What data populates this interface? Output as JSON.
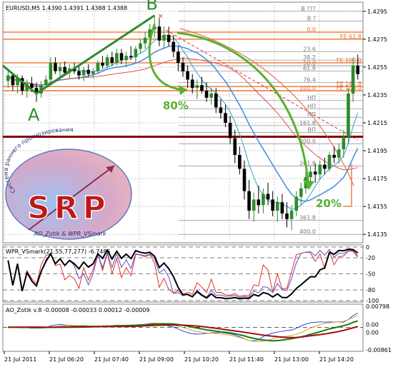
{
  "colors": {
    "bull": "#2e8b2e",
    "bear": "#000000",
    "green_annot": "#58b030",
    "orange": "#f08040",
    "darkred": "#800000",
    "blue": "#3c8ce0",
    "wpr_red": "#e03030"
  },
  "chart_data": [
    {
      "type": "candlestick",
      "header": "EURUSD,M5  1.4390 1.4391 1.4388 1.4388",
      "ylim": [
        1.413,
        1.43
      ],
      "y_ticks": [
        "1.4295",
        "1.4275",
        "1.4255",
        "1.4235",
        "1.4215",
        "1.4195",
        "1.4175",
        "1.4155",
        "1.4135"
      ],
      "x_ticks": [
        "21 Jul 2011",
        "21 Jul 06:20",
        "21 Jul 07:40",
        "21 Jul 09:00",
        "21 Jul 10:20",
        "21 Jul 11:40",
        "21 Jul 13:00",
        "21 Jul 14:20"
      ],
      "candles": [
        [
          1.4245,
          1.4252,
          1.424,
          1.4249
        ],
        [
          1.4249,
          1.4251,
          1.4238,
          1.4242
        ],
        [
          1.4242,
          1.425,
          1.4236,
          1.4247
        ],
        [
          1.4247,
          1.4249,
          1.4235,
          1.4238
        ],
        [
          1.4238,
          1.4246,
          1.4233,
          1.4243
        ],
        [
          1.4243,
          1.4248,
          1.4237,
          1.424
        ],
        [
          1.424,
          1.4244,
          1.423,
          1.4236
        ],
        [
          1.4236,
          1.4245,
          1.4233,
          1.4242
        ],
        [
          1.4242,
          1.4249,
          1.424,
          1.4246
        ],
        [
          1.4246,
          1.4262,
          1.4244,
          1.4258
        ],
        [
          1.4258,
          1.4262,
          1.425,
          1.4252
        ],
        [
          1.4252,
          1.4258,
          1.4248,
          1.4255
        ],
        [
          1.4255,
          1.4259,
          1.4249,
          1.4251
        ],
        [
          1.4251,
          1.4257,
          1.4247,
          1.4254
        ],
        [
          1.4254,
          1.4258,
          1.425,
          1.4252
        ],
        [
          1.4252,
          1.4256,
          1.4246,
          1.4249
        ],
        [
          1.4249,
          1.4255,
          1.4245,
          1.4253
        ],
        [
          1.4253,
          1.4257,
          1.4248,
          1.425
        ],
        [
          1.425,
          1.4254,
          1.4247,
          1.4252
        ],
        [
          1.4252,
          1.426,
          1.425,
          1.4258
        ],
        [
          1.4258,
          1.4263,
          1.4254,
          1.4256
        ],
        [
          1.4256,
          1.4264,
          1.4254,
          1.4262
        ],
        [
          1.4262,
          1.4266,
          1.4256,
          1.4258
        ],
        [
          1.4258,
          1.4268,
          1.4256,
          1.4265
        ],
        [
          1.4265,
          1.4268,
          1.4257,
          1.426
        ],
        [
          1.426,
          1.4266,
          1.4255,
          1.4263
        ],
        [
          1.4263,
          1.427,
          1.426,
          1.4262
        ],
        [
          1.4262,
          1.427,
          1.4258,
          1.4268
        ],
        [
          1.4268,
          1.4275,
          1.4265,
          1.4272
        ],
        [
          1.4272,
          1.428,
          1.4268,
          1.4276
        ],
        [
          1.4276,
          1.4286,
          1.4272,
          1.4282
        ],
        [
          1.4282,
          1.4292,
          1.4276,
          1.4284
        ],
        [
          1.4284,
          1.429,
          1.427,
          1.4274
        ],
        [
          1.4274,
          1.4284,
          1.4268,
          1.4278
        ],
        [
          1.4278,
          1.4284,
          1.427,
          1.4273
        ],
        [
          1.4273,
          1.4278,
          1.4262,
          1.4266
        ],
        [
          1.4266,
          1.427,
          1.4252,
          1.4258
        ],
        [
          1.4258,
          1.4262,
          1.4248,
          1.4252
        ],
        [
          1.4252,
          1.4256,
          1.424,
          1.4246
        ],
        [
          1.4246,
          1.425,
          1.4236,
          1.424
        ],
        [
          1.424,
          1.4246,
          1.4232,
          1.4242
        ],
        [
          1.4242,
          1.4248,
          1.4236,
          1.4238
        ],
        [
          1.4238,
          1.4244,
          1.423,
          1.4233
        ],
        [
          1.4233,
          1.424,
          1.4228,
          1.4236
        ],
        [
          1.4236,
          1.424,
          1.4222,
          1.4226
        ],
        [
          1.4226,
          1.4232,
          1.4218,
          1.4222
        ],
        [
          1.4222,
          1.4228,
          1.4212,
          1.4215
        ],
        [
          1.4215,
          1.422,
          1.42,
          1.4204
        ],
        [
          1.4204,
          1.421,
          1.4186,
          1.4192
        ],
        [
          1.4192,
          1.4198,
          1.4178,
          1.4182
        ],
        [
          1.4182,
          1.4188,
          1.416,
          1.4166
        ],
        [
          1.4166,
          1.4174,
          1.4146,
          1.4152
        ],
        [
          1.4152,
          1.4165,
          1.4144,
          1.416
        ],
        [
          1.416,
          1.417,
          1.415,
          1.4156
        ],
        [
          1.4156,
          1.4168,
          1.415,
          1.4164
        ],
        [
          1.4164,
          1.4172,
          1.4156,
          1.416
        ],
        [
          1.416,
          1.4166,
          1.4148,
          1.4152
        ],
        [
          1.4152,
          1.4162,
          1.4144,
          1.4158
        ],
        [
          1.4158,
          1.4164,
          1.4146,
          1.415
        ],
        [
          1.415,
          1.4158,
          1.414,
          1.4146
        ],
        [
          1.4146,
          1.4156,
          1.4138,
          1.4152
        ],
        [
          1.4152,
          1.4166,
          1.4148,
          1.4162
        ],
        [
          1.4162,
          1.4172,
          1.4156,
          1.4168
        ],
        [
          1.4168,
          1.418,
          1.4164,
          1.4176
        ],
        [
          1.4176,
          1.4184,
          1.417,
          1.418
        ],
        [
          1.418,
          1.4186,
          1.4172,
          1.4178
        ],
        [
          1.4178,
          1.4188,
          1.4174,
          1.4185
        ],
        [
          1.4185,
          1.419,
          1.4178,
          1.4182
        ],
        [
          1.4182,
          1.4194,
          1.418,
          1.4192
        ],
        [
          1.4192,
          1.4198,
          1.4186,
          1.419
        ],
        [
          1.419,
          1.42,
          1.4186,
          1.4196
        ],
        [
          1.4196,
          1.421,
          1.419,
          1.4205
        ],
        [
          1.4205,
          1.424,
          1.42,
          1.4236
        ],
        [
          1.4236,
          1.4262,
          1.423,
          1.4256
        ],
        [
          1.4256,
          1.4264,
          1.4246,
          1.425
        ]
      ],
      "fib_levels": [
        {
          "label": "B ???",
          "price": 1.4295,
          "color": "#777777"
        },
        {
          "label": "B ?",
          "price": 1.4288,
          "color": "#777777"
        },
        {
          "label": "0.0",
          "price": 1.428,
          "color": "#e07030"
        },
        {
          "label": "23.6",
          "price": 1.4266,
          "color": "#777777"
        },
        {
          "label": "38.2",
          "price": 1.426,
          "color": "#777777"
        },
        {
          "label": "50.0",
          "price": 1.4256,
          "color": "#777777"
        },
        {
          "label": "61.8",
          "price": 1.4252,
          "color": "#777777"
        },
        {
          "label": "76.4",
          "price": 1.4244,
          "color": "#777777"
        },
        {
          "label": "100.0",
          "price": 1.4238,
          "color": "#e07030"
        },
        {
          "label": "НП",
          "price": 1.4231,
          "color": "#777777"
        },
        {
          "label": "НП",
          "price": 1.4225,
          "color": "#777777"
        },
        {
          "label": "НП",
          "price": 1.4219,
          "color": "#777777"
        },
        {
          "label": "161.8",
          "price": 1.4213,
          "color": "#777777"
        },
        {
          "label": "ВП",
          "price": 1.4208,
          "color": "#777777"
        },
        {
          "label": "200.0",
          "price": 1.42,
          "color": "#777777"
        },
        {
          "label": "261.8",
          "price": 1.4184,
          "color": "#777777"
        },
        {
          "label": "361.8",
          "price": 1.4145,
          "color": "#777777"
        },
        {
          "label": "400.0",
          "price": 1.4135,
          "color": "#777777"
        }
      ],
      "fe_levels": [
        {
          "label": "FE 61.8",
          "price": 1.4275
        },
        {
          "label": "FE 100.0",
          "price": 1.4258
        },
        {
          "label": "FE 161.8",
          "price": 1.4241
        },
        {
          "label": "FE 100.0",
          "price": 1.4238
        }
      ],
      "support_price": 1.4205,
      "annotations": {
        "point_a": "A",
        "point_b": "B",
        "pct_80": "80%",
        "pct_20": "20%"
      },
      "logo": {
        "title": "SRP",
        "arc_text": "Система раннего прогнозирования",
        "credit": "AO_Zotik & WPR_VSmark"
      }
    },
    {
      "type": "line",
      "header": "WPR_VSmark(21,55,77,277) -6.7485",
      "ylim": [
        -100,
        0
      ],
      "y_ticks": [
        "0",
        "-20",
        "-50",
        "-80",
        "-100"
      ]
    },
    {
      "type": "line",
      "header": "AO_Zotik v.8 -0.00008 -0.00033 0.00012 -0.00009",
      "ylim": [
        -0.00861,
        0.00798
      ],
      "y_ticks": [
        "0.00798",
        "0.00",
        "0.00",
        "-0.00861"
      ]
    }
  ]
}
